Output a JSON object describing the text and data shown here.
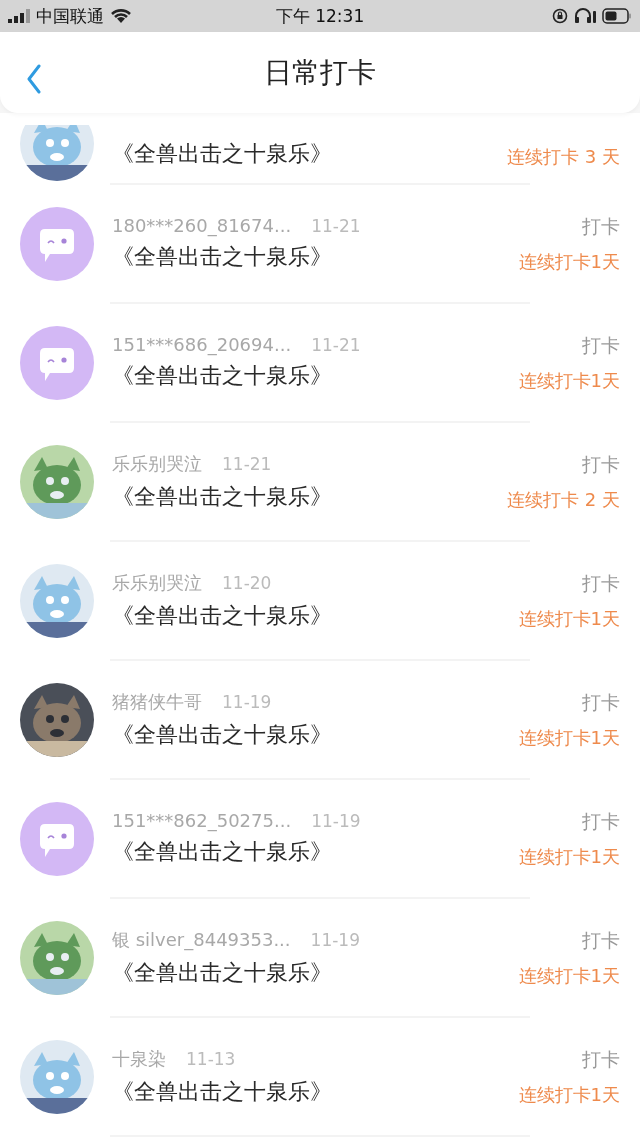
{
  "status_bar": {
    "carrier": "中国联通",
    "time": "下午 12:31"
  },
  "header": {
    "title": "日常打卡"
  },
  "entries": [
    {
      "title": "《全兽出击之十泉乐》",
      "streak": "连续打卡 3 天"
    },
    {
      "avatar": {
        "kind": "default"
      },
      "name": "180***260_81674...",
      "date": "11-21",
      "action": "打卡",
      "title": "《全兽出击之十泉乐》",
      "streak": "连续打卡1天"
    },
    {
      "avatar": {
        "kind": "default"
      },
      "name": "151***686_20694...",
      "date": "11-21",
      "action": "打卡",
      "title": "《全兽出击之十泉乐》",
      "streak": "连续打卡1天"
    },
    {
      "name": "乐乐别哭泣",
      "date": "11-21",
      "action": "打卡",
      "title": "《全兽出击之十泉乐》",
      "streak": "连续打卡 2 天"
    },
    {
      "name": "乐乐别哭泣",
      "date": "11-20",
      "action": "打卡",
      "title": "《全兽出击之十泉乐》",
      "streak": "连续打卡1天"
    },
    {
      "name": "猪猪侠牛哥",
      "date": "11-19",
      "action": "打卡",
      "title": "《全兽出击之十泉乐》",
      "streak": "连续打卡1天"
    },
    {
      "avatar": {
        "kind": "default"
      },
      "name": "151***862_50275...",
      "date": "11-19",
      "action": "打卡",
      "title": "《全兽出击之十泉乐》",
      "streak": "连续打卡1天"
    },
    {
      "name": "银 silver_8449353...",
      "date": "11-19",
      "action": "打卡",
      "title": "《全兽出击之十泉乐》",
      "streak": "连续打卡1天"
    },
    {
      "name": "十泉染",
      "date": "11-13",
      "action": "打卡",
      "title": "《全兽出击之十泉乐》",
      "streak": "连续打卡1天"
    }
  ]
}
